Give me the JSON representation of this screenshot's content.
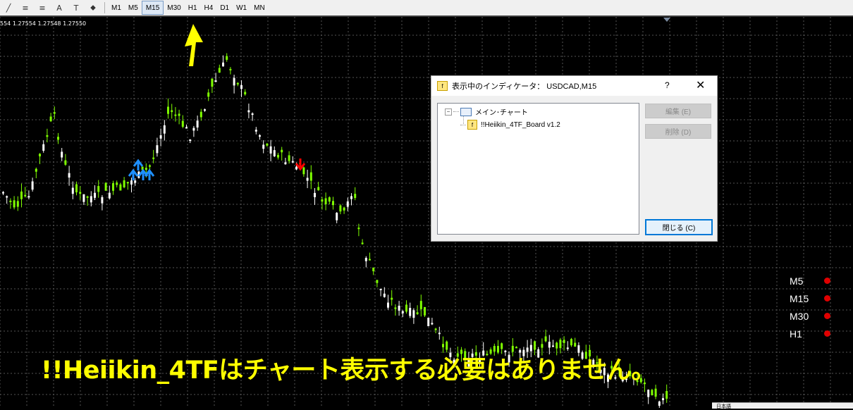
{
  "toolbar": {
    "tools": [
      {
        "name": "line-tool-icon",
        "glyph": "╱"
      },
      {
        "name": "fibo-expansion-icon",
        "glyph": "≡"
      },
      {
        "name": "fibo-fan-icon",
        "glyph": "≡"
      },
      {
        "name": "text-tool-icon",
        "glyph": "A"
      },
      {
        "name": "text-label-icon",
        "glyph": "T"
      },
      {
        "name": "arrow-tool-icon",
        "glyph": "⬥"
      }
    ],
    "timeframes": [
      "M1",
      "M5",
      "M15",
      "M30",
      "H1",
      "H4",
      "D1",
      "W1",
      "MN"
    ],
    "active_timeframe": "M15"
  },
  "price_line": "554 1.27554 1.27548 1.27550",
  "dialog": {
    "title": "表示中のインディケータ： USDCAD,M15",
    "help": "?",
    "close": "✕",
    "tree": {
      "root": "メイン･チャート",
      "child": "!!Heiikin_4TF_Board v1.2"
    },
    "buttons": {
      "edit": "編集 (E)",
      "delete": "削除 (D)",
      "close": "閉じる (C)"
    }
  },
  "tf_panel": [
    {
      "label": "M5",
      "status_color": "#e00000"
    },
    {
      "label": "M15",
      "status_color": "#e00000"
    },
    {
      "label": "M30",
      "status_color": "#e00000"
    },
    {
      "label": "H1",
      "status_color": "#e00000"
    }
  ],
  "caption": "!!Heiikin_4TFはチャート表示する必要はありません。",
  "bottom_panel": "日本語",
  "colors": {
    "bull_candle": "#ffffff",
    "bear_candle": "#7fff00",
    "grid": "#555555",
    "annotation_arrow": "#ffff00",
    "buy_signal": "#1e90ff",
    "sell_signal": "#ff0000"
  }
}
